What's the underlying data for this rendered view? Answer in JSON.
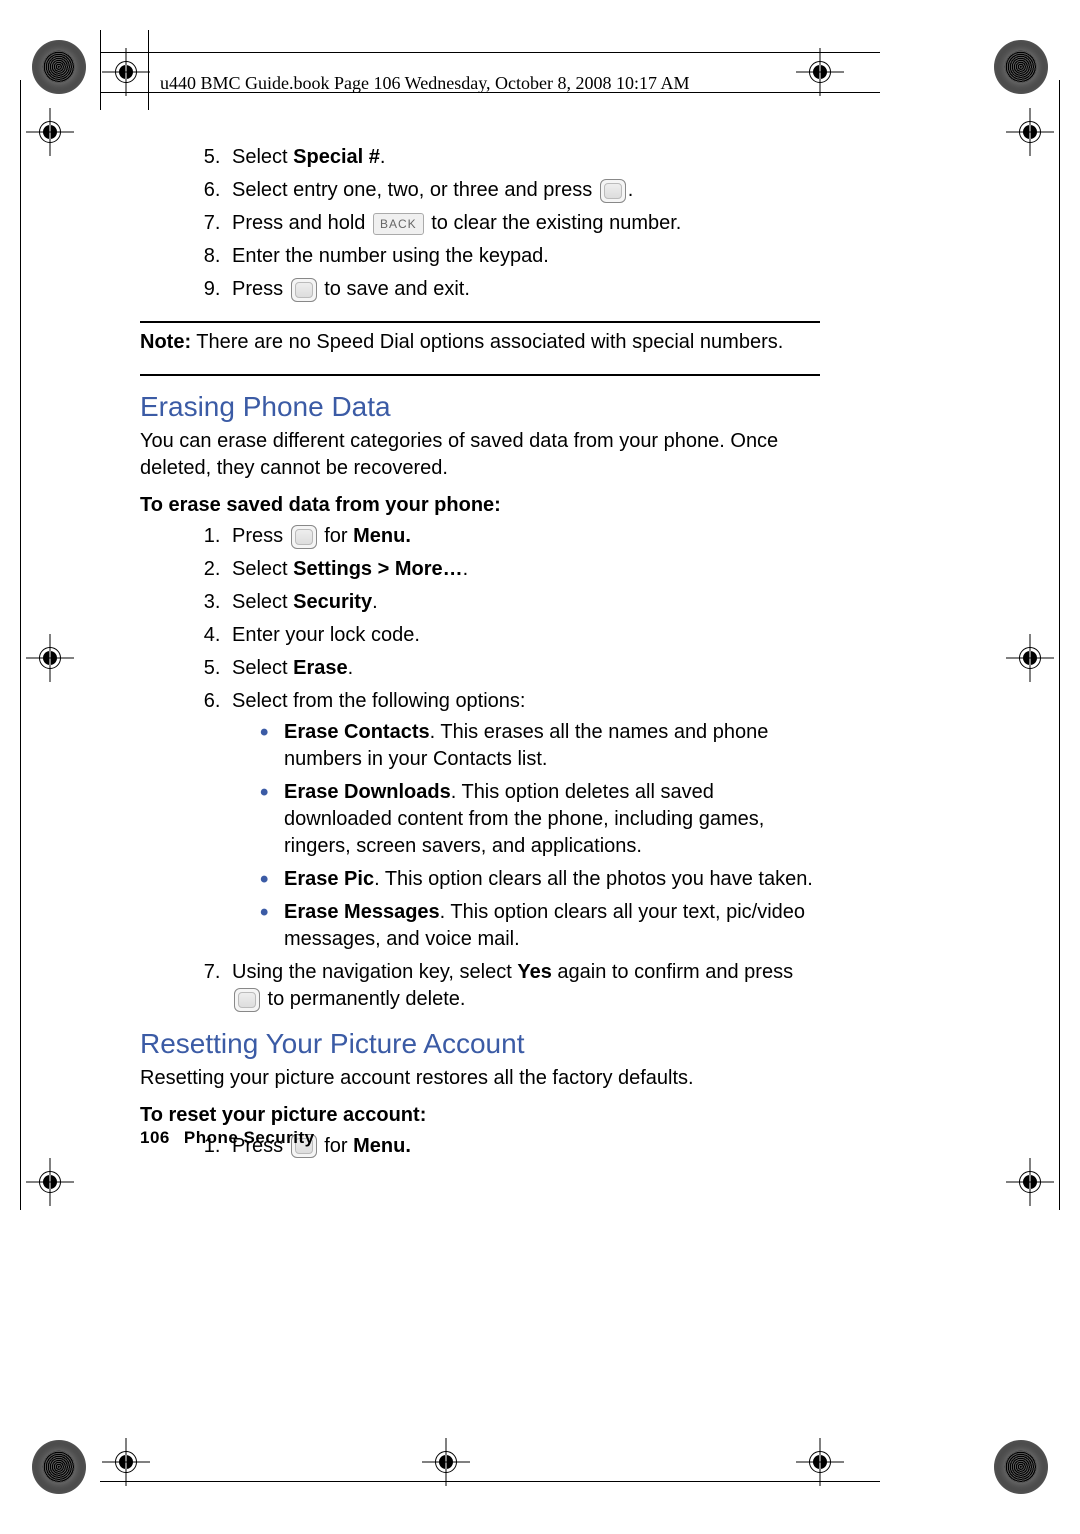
{
  "header": "u440 BMC Guide.book  Page 106  Wednesday, October 8, 2008  10:17 AM",
  "steps_top": {
    "s5_pre": "Select ",
    "s5_bold": "Special #",
    "s5_post": ".",
    "s6_pre": "Select entry one, two, or three and press ",
    "s6_post": ".",
    "s7_pre": "Press and hold ",
    "s7_back": "BACK",
    "s7_post": " to clear the existing number.",
    "s8": "Enter the number using the keypad.",
    "s9_pre": "Press ",
    "s9_post": " to save and exit."
  },
  "note": {
    "label": "Note:",
    "text": " There are no Speed Dial options associated with special numbers."
  },
  "erase": {
    "heading": "Erasing Phone Data",
    "intro": "You can erase different categories of saved data from your phone. Once deleted, they cannot be recovered.",
    "subhead": "To erase saved data from your phone:",
    "s1_pre": "Press ",
    "s1_mid": " for ",
    "s1_bold": "Menu.",
    "s2_pre": "Select ",
    "s2_bold": "Settings > More…",
    "s2_post": ".",
    "s3_pre": "Select ",
    "s3_bold": "Security",
    "s3_post": ".",
    "s4": "Enter your lock code.",
    "s5_pre": "Select ",
    "s5_bold": "Erase",
    "s5_post": ".",
    "s6": "Select from the following options:",
    "b1_bold": "Erase Contacts",
    "b1_text": ". This erases all the names and phone numbers in your Contacts list.",
    "b2_bold": "Erase Downloads",
    "b2_text": ". This option deletes all saved downloaded content from the phone, including games, ringers, screen savers, and applications.",
    "b3_bold": "Erase Pic",
    "b3_text": ". This option clears all the photos you have taken.",
    "b4_bold": "Erase Messages",
    "b4_text": ". This option clears all your text, pic/video messages, and voice mail.",
    "s7_pre": "Using the navigation key, select ",
    "s7_bold": "Yes",
    "s7_mid": " again to confirm and press ",
    "s7_post": " to permanently delete."
  },
  "reset": {
    "heading": "Resetting Your Picture Account",
    "intro": "Resetting your picture account restores all the factory defaults.",
    "subhead": "To reset your picture account:",
    "s1_pre": "Press ",
    "s1_mid": " for ",
    "s1_bold": "Menu."
  },
  "footer": {
    "page": "106",
    "section": "Phone Security"
  }
}
